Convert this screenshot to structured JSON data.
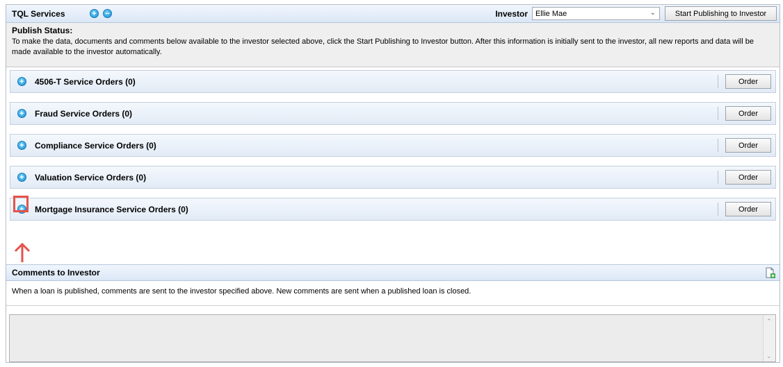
{
  "header": {
    "title": "TQL Services",
    "investor_label": "Investor",
    "investor_value": "Ellie Mae",
    "publish_button": "Start Publishing to Investor"
  },
  "status": {
    "title": "Publish Status:",
    "body": "To make the data, documents and comments below available to the investor selected above, click the Start Publishing to Investor button. After this information is initially sent to the investor, all new reports and data will be made available to the investor automatically."
  },
  "sections": [
    {
      "label": "4506-T Service Orders (0)",
      "button": "Order"
    },
    {
      "label": "Fraud Service Orders (0)",
      "button": "Order"
    },
    {
      "label": "Compliance Service Orders (0)",
      "button": "Order"
    },
    {
      "label": "Valuation Service Orders (0)",
      "button": "Order"
    },
    {
      "label": "Mortgage Insurance Service Orders (0)",
      "button": "Order"
    }
  ],
  "comments": {
    "title": "Comments to Investor",
    "body": "When a loan is published, comments are sent to the investor specified above. New comments are sent when a published loan is closed."
  },
  "colors": {
    "accent": "#1b8fd6",
    "highlight": "#e5534b"
  },
  "icons": {
    "expand": "expand-plus-icon",
    "collapse": "collapse-minus-icon",
    "add_comment": "add-comment-icon",
    "annotation_arrow": "up-arrow-icon"
  }
}
